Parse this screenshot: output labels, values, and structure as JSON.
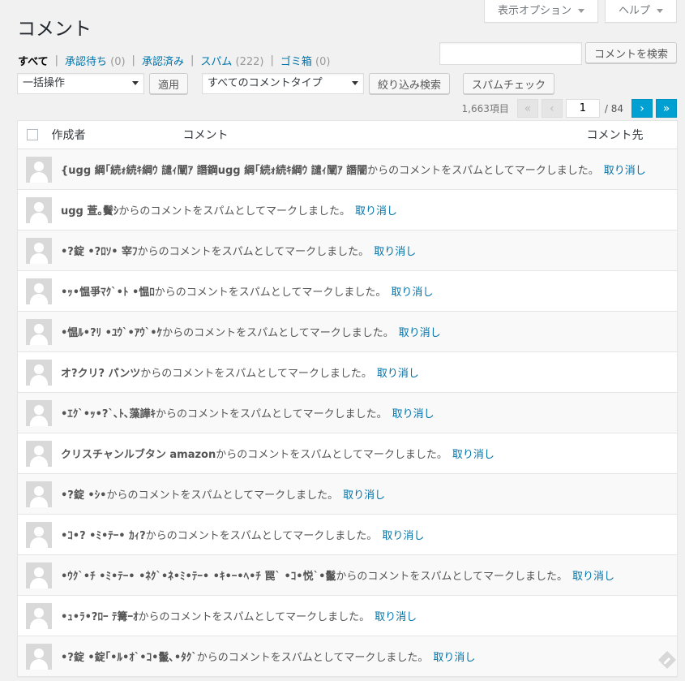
{
  "header": {
    "screen_options": "表示オプション",
    "help": "ヘルプ",
    "title": "コメント"
  },
  "filters": {
    "all": "すべて",
    "pending": "承認待ち",
    "pending_count": "(0)",
    "approved": "承認済み",
    "spam": "スパム",
    "spam_count": "(222)",
    "trash": "ゴミ箱",
    "trash_count": "(0)"
  },
  "search": {
    "value": "",
    "button": "コメントを検索"
  },
  "toolbar": {
    "bulk_action": "一括操作",
    "apply": "適用",
    "comment_type": "すべてのコメントタイプ",
    "filter": "絞り込み検索",
    "spam_check": "スパムチェック"
  },
  "pagination": {
    "items": "1,663項目",
    "first": "«",
    "prev": "‹",
    "current": "1",
    "total": "/ 84",
    "next": "›",
    "last": "»"
  },
  "table": {
    "columns": {
      "author": "作成者",
      "comment": "コメント",
      "response": "コメント先"
    },
    "spam_suffix": "からのコメントをスパムとしてマークしました。",
    "undo_label": "取り消し",
    "rows": [
      {
        "author": "{ugg 綱｢続ｫ続ｷ綱ｳ 譴ｨ闡ｱ 譖鋼ugg 綱｢続ｫ続ｷ綱ｳ 譴ｨ闡ｱ 譖闇"
      },
      {
        "author": "ugg 萱｡鬢ｼ"
      },
      {
        "author": "•?錠 •?ﾛｿ• 宰ﾌ"
      },
      {
        "author": "•ｯ•愠爭ﾏｸ`•ﾄ •愠ﾛ"
      },
      {
        "author": "•愠ﾙ•?ﾘ •ﾕｳ`•ｱｳ`•ｹ"
      },
      {
        "author": "オ?クリ? パンツ"
      },
      {
        "author": "•ｴｸ`•ｯ•?`､ﾄ､藻譁ｷ"
      },
      {
        "author": "クリスチャンルブタン amazon"
      },
      {
        "author": "•?錠 •ｼ•"
      },
      {
        "author": "•ｺ•? •ﾐ•ﾃｰ• ｶｨ?"
      },
      {
        "author": "•ｳｸ`•ﾁ •ﾐ•ﾃｰ• •ﾈｸ`•ﾈ•ﾐ•ﾃｰ• •ｷ•ｰ•ﾍ•ﾁ 罠` •ｺ•悦`•鬣"
      },
      {
        "author": "•ｭ•ﾗ•?ﾛｰ ﾃ篝ｰｵ"
      },
      {
        "author": "•?錠 •錠｢•ﾙ•ｵ`•ｺ•鬣､•ﾀｸ`"
      }
    ]
  },
  "colors": {
    "link": "#0073aa",
    "background": "#f1f1f1",
    "pagination_active": "#00a0d2"
  }
}
